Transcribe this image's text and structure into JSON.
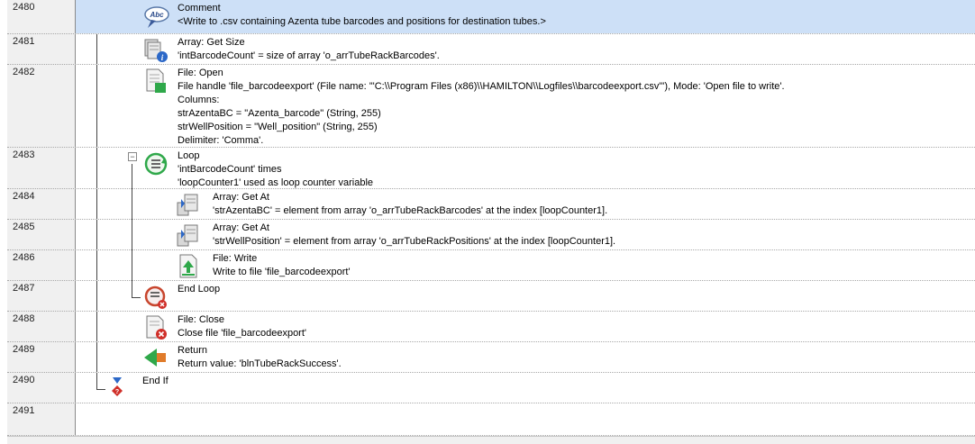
{
  "colors": {
    "selected_row": "#cde0f7",
    "line_number_bg": "#f0f0f0"
  },
  "rows": [
    {
      "line": "2480",
      "icon": "comment-icon",
      "lines": [
        "Comment",
        "<Write to .csv containing Azenta tube barcodes and positions for destination tubes.>"
      ]
    },
    {
      "line": "2481",
      "icon": "array-size-icon",
      "lines": [
        "Array: Get Size",
        "'intBarcodeCount' = size of array 'o_arrTubeRackBarcodes'."
      ]
    },
    {
      "line": "2482",
      "icon": "file-open-icon",
      "lines": [
        "File: Open",
        "File handle 'file_barcodeexport' (File name: '\"C:\\\\Program Files (x86)\\\\HAMILTON\\\\Logfiles\\\\barcodeexport.csv\"'),  Mode: 'Open file to write'.",
        "Columns:",
        "strAzentaBC = \"Azenta_barcode\" (String, 255)",
        "strWellPosition = \"Well_position\" (String, 255)",
        "Delimiter: 'Comma'."
      ]
    },
    {
      "line": "2483",
      "icon": "loop-icon",
      "lines": [
        "Loop",
        "'intBarcodeCount' times",
        "'loopCounter1' used as loop counter variable"
      ]
    },
    {
      "line": "2484",
      "icon": "array-get-at-icon",
      "lines": [
        "Array: Get At",
        "'strAzentaBC' = element from array 'o_arrTubeRackBarcodes' at the index [loopCounter1]."
      ]
    },
    {
      "line": "2485",
      "icon": "array-get-at-icon",
      "lines": [
        "Array: Get At",
        "'strWellPosition' = element from array 'o_arrTubeRackPositions' at the index [loopCounter1]."
      ]
    },
    {
      "line": "2486",
      "icon": "file-write-icon",
      "lines": [
        "File: Write",
        "Write to file 'file_barcodeexport'"
      ]
    },
    {
      "line": "2487",
      "icon": "end-loop-icon",
      "lines": [
        "End Loop"
      ]
    },
    {
      "line": "2488",
      "icon": "file-close-icon",
      "lines": [
        "File: Close",
        "Close file 'file_barcodeexport'"
      ]
    },
    {
      "line": "2489",
      "icon": "return-icon",
      "lines": [
        "Return",
        "Return value: 'blnTubeRackSuccess'."
      ]
    },
    {
      "line": "2490",
      "icon": "end-if-icon",
      "lines": [
        "End If"
      ]
    },
    {
      "line": "2491",
      "icon": "",
      "lines": []
    }
  ]
}
